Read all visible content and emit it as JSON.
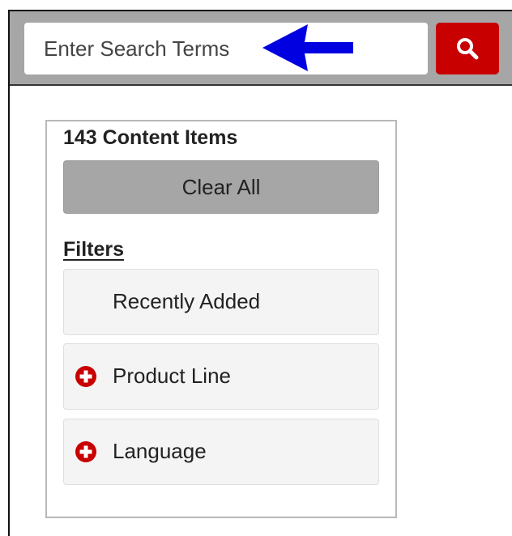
{
  "search": {
    "placeholder": "Enter Search Terms",
    "button_icon": "search-icon",
    "button_color": "#c80000",
    "arrow_color": "#0000e0"
  },
  "panel": {
    "count_label": "143 Content Items",
    "clear_all_label": "Clear All",
    "filters_heading": "Filters",
    "filters": [
      {
        "label": "Recently Added",
        "icon": null
      },
      {
        "label": "Product Line",
        "icon": "plus-circle-icon"
      },
      {
        "label": "Language",
        "icon": "plus-circle-icon"
      }
    ]
  }
}
